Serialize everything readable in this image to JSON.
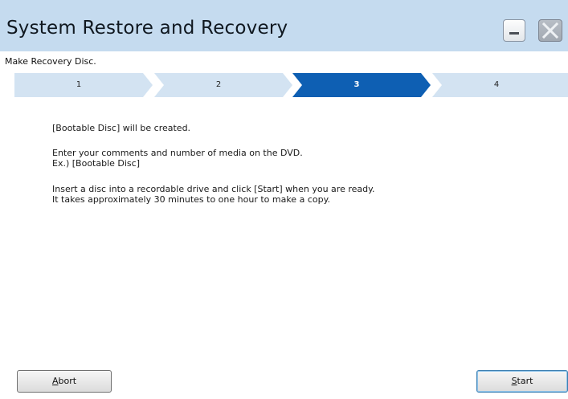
{
  "window": {
    "title": "System Restore and Recovery"
  },
  "page": {
    "subtitle": "Make Recovery Disc."
  },
  "steps": [
    {
      "label": "1",
      "active": false
    },
    {
      "label": "2",
      "active": false
    },
    {
      "label": "3",
      "active": true
    },
    {
      "label": "4",
      "active": false
    }
  ],
  "colors": {
    "titlebar": "#c5dbef",
    "step_inactive": "#d3e3f2",
    "step_active": "#0e5fb3"
  },
  "content": {
    "line1": "[Bootable Disc] will be created.",
    "line2": "Enter your comments and number of media on the DVD.",
    "line3": "Ex.) [Bootable Disc]",
    "line4": "Insert a disc into a recordable drive and click [Start] when you are ready.",
    "line5": "It takes approximately 30 minutes to one hour to make a copy."
  },
  "buttons": {
    "abort_accel": "A",
    "abort_rest": "bort",
    "start_accel": "S",
    "start_rest": "tart"
  },
  "icons": {
    "minimize": "minimize-icon",
    "close": "close-icon"
  }
}
